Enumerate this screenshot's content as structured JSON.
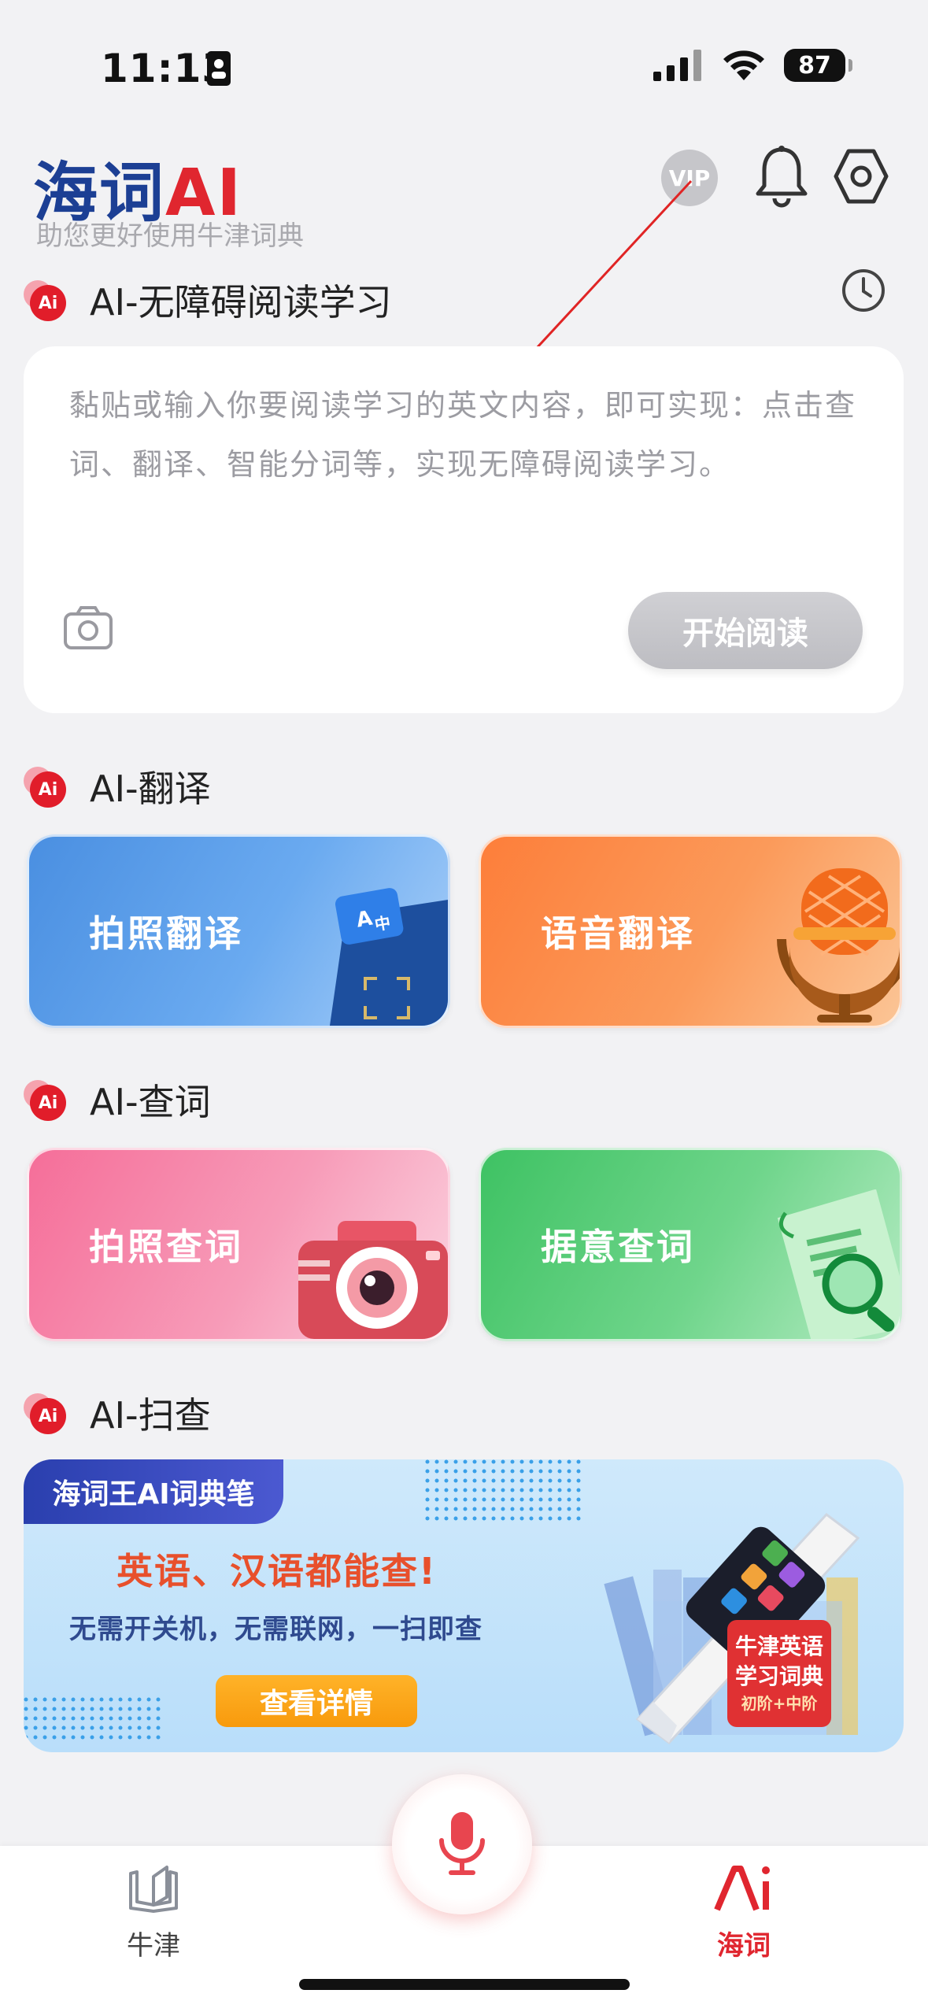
{
  "status_bar": {
    "time": "11:13",
    "battery": "87"
  },
  "header": {
    "logo_cn": "海词",
    "logo_ai": "AI",
    "subtitle": "助您更好使用牛津词典",
    "vip_label": "VIP"
  },
  "reading": {
    "badge": "Ai",
    "title": "AI-无障碍阅读学习",
    "placeholder": "黏贴或输入你要阅读学习的英文内容，即可实现：点击查词、翻译、智能分词等，实现无障碍阅读学习。",
    "start_button": "开始阅读"
  },
  "translate": {
    "badge": "Ai",
    "title": "AI-翻译",
    "cards": [
      {
        "label": "拍照翻译",
        "icon": "camera-translate-icon"
      },
      {
        "label": "语音翻译",
        "icon": "microphone-icon"
      }
    ]
  },
  "lookup": {
    "badge": "Ai",
    "title": "AI-查词",
    "cards": [
      {
        "label": "拍照查词",
        "icon": "camera-icon"
      },
      {
        "label": "据意查词",
        "icon": "magnifier-doc-icon"
      }
    ]
  },
  "scan": {
    "badge": "Ai",
    "title": "AI-扫查",
    "banner": {
      "tag": "海词王AI词典笔",
      "headline": "英语、汉语都能查!",
      "subline": "无需开关机，无需联网，一扫即查",
      "button": "查看详情",
      "book_title_1": "牛津英语",
      "book_title_2": "学习词典",
      "book_level": "初阶+中阶"
    }
  },
  "tabbar": {
    "tabs": [
      {
        "label": "牛津",
        "icon": "book-icon",
        "active": false
      },
      {
        "label": "海词",
        "icon": "ai-logo-icon",
        "active": true
      }
    ]
  },
  "colors": {
    "brand_blue": "#1c3f94",
    "brand_red": "#e0262f",
    "active_tab": "#e0262f"
  }
}
